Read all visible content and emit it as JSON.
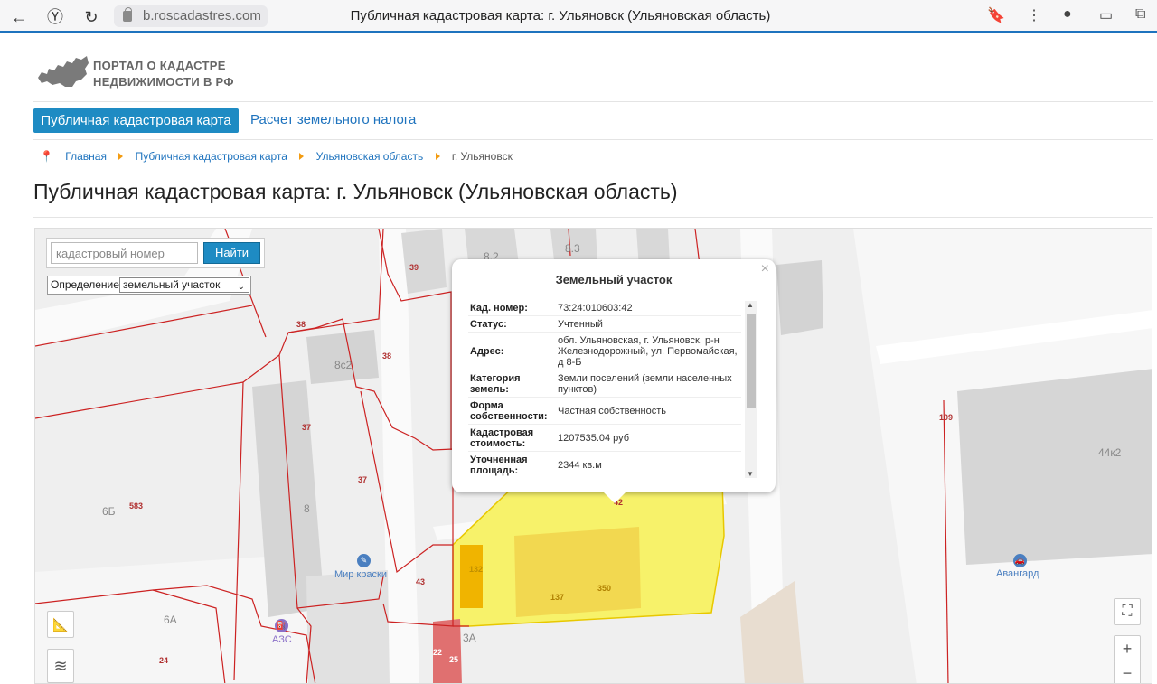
{
  "browser": {
    "url": "b.roscadastres.com",
    "tab_title": "Публичная кадастровая карта: г. Ульяновск (Ульяновская область)"
  },
  "header": {
    "logo_line1": "ПОРТАЛ О КАДАСТРЕ",
    "logo_line2": "НЕДВИЖИМОСТИ В РФ",
    "tab_active": "Публичная кадастровая карта",
    "tab_link": "Расчет земельного налога"
  },
  "breadcrumbs": {
    "items": [
      "Главная",
      "Публичная кадастровая карта",
      "Ульяновская область"
    ],
    "current": "г. Ульяновск"
  },
  "page": {
    "title": "Публичная кадастровая карта: г. Ульяновск (Ульяновская область)"
  },
  "search": {
    "placeholder": "кадастровый номер",
    "button": "Найти",
    "definition_label": "Определение:",
    "definition_value": "земельный участок"
  },
  "popup": {
    "title": "Земельный участок",
    "rows": [
      {
        "k": "Кад. номер:",
        "v": "73:24:010603:42"
      },
      {
        "k": "Статус:",
        "v": "Учтенный"
      },
      {
        "k": "Адрес:",
        "v": "обл. Ульяновская, г. Ульяновск, р-н Железнодорожный, ул. Первомайская, д 8-Б"
      },
      {
        "k": "Категория земель:",
        "v": "Земли поселений (земли населенных пунктов)"
      },
      {
        "k": "Форма собственности:",
        "v": "Частная собственность"
      },
      {
        "k": "Кадастровая стоимость:",
        "v": "1207535.04 руб"
      },
      {
        "k": "Уточненная площадь:",
        "v": "2344 кв.м"
      }
    ]
  },
  "map": {
    "labels": [
      "8.2",
      "8.3",
      "8с2",
      "8",
      "6Б",
      "6А",
      "3А",
      "44к2"
    ],
    "numbers": [
      "39",
      "38",
      "38",
      "37",
      "37",
      "583",
      "43",
      "24",
      "42",
      "132",
      "137",
      "350",
      "22",
      "25",
      "109"
    ],
    "poi": [
      "Мир краски",
      "АЗС",
      "Авангард"
    ]
  }
}
